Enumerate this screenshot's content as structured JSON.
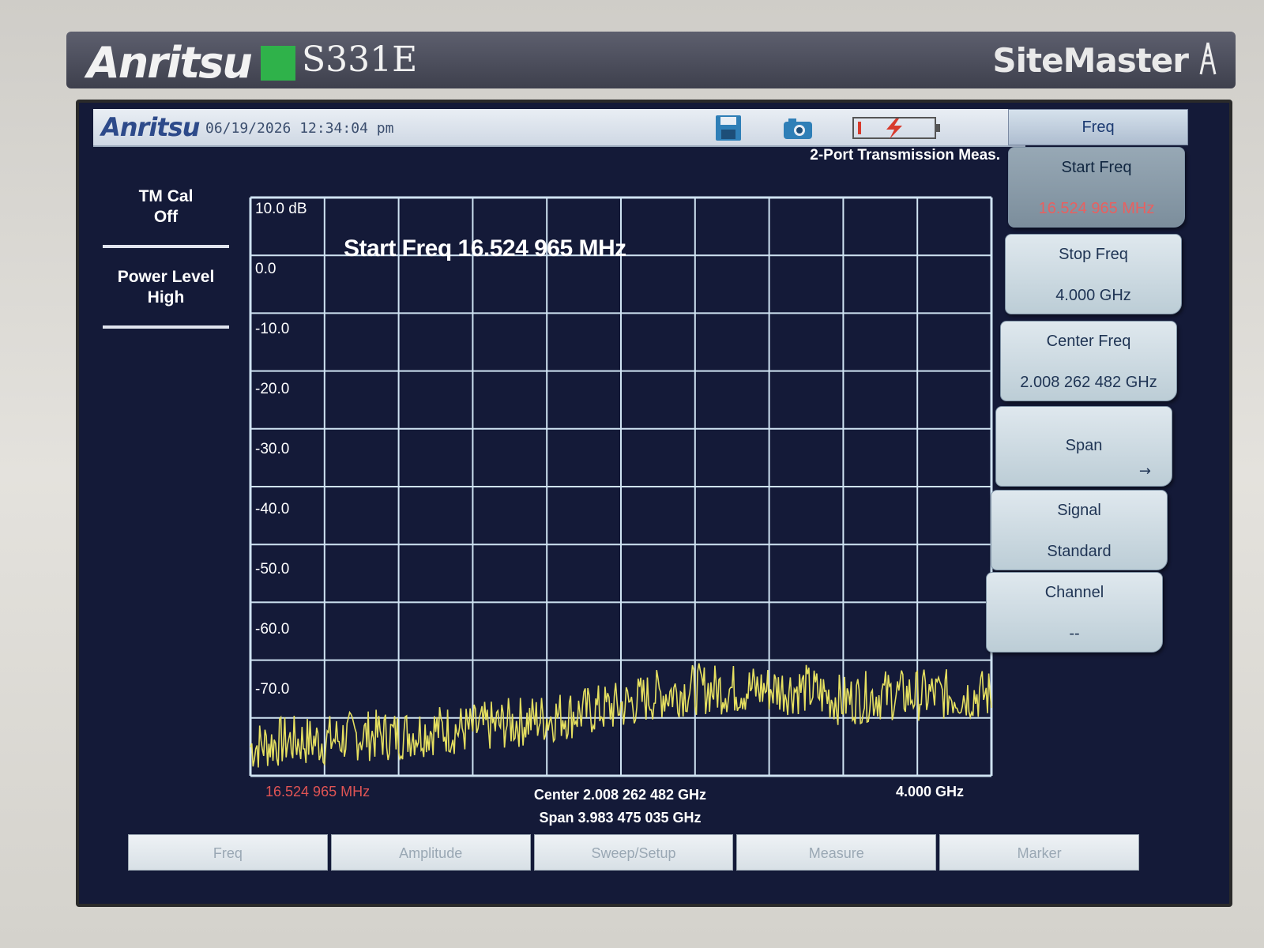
{
  "device": {
    "brand": "Anritsu",
    "model": "S331E",
    "product": "SiteMaster"
  },
  "status": {
    "logo": "Anritsu",
    "datetime": "06/19/2026 12:34:04 pm",
    "measurement_title": "2-Port Transmission Meas."
  },
  "left_panel": {
    "items": [
      {
        "line1": "TM Cal",
        "line2": "Off"
      },
      {
        "line1": "Power Level",
        "line2": "High"
      }
    ]
  },
  "plot": {
    "annotation": "Start Freq 16.524 965 MHz",
    "y_tick_labels": [
      "10.0 dB",
      "0.0",
      "-10.0",
      "-20.0",
      "-30.0",
      "-40.0",
      "-50.0",
      "-60.0",
      "-70.0"
    ],
    "x_start": "16.524 965 MHz",
    "x_center": "Center 2.008 262 482 GHz",
    "x_span": "Span 3.983 475 035 GHz",
    "x_stop": "4.000 GHz",
    "trace_color": "#e6e060",
    "grid_color": "#cfe3f2"
  },
  "chart_data": {
    "type": "line",
    "ylim": [
      -90,
      10
    ],
    "xlim_ghz": [
      0.016524965,
      4.0
    ],
    "series": [
      {
        "x_ghz": [
          0.0165,
          0.2,
          0.4,
          0.6,
          0.8,
          1.0,
          1.2,
          1.4,
          1.6,
          1.8,
          2.0,
          2.2,
          2.4,
          2.6,
          2.8,
          3.0,
          3.2,
          3.4,
          3.6,
          3.8,
          4.0
        ],
        "y_db": [
          -85,
          -84,
          -84,
          -83,
          -83,
          -82,
          -82,
          -81,
          -80,
          -79,
          -78,
          -76,
          -75,
          -75,
          -75,
          -75,
          -77,
          -76,
          -76,
          -76,
          -76
        ]
      }
    ]
  },
  "softkeys": {
    "title": "Freq",
    "keys": [
      {
        "line1": "Start Freq",
        "line2": "16.524 965 MHz"
      },
      {
        "line1": "Stop Freq",
        "line2": "4.000 GHz"
      },
      {
        "line1": "Center Freq",
        "line2": "2.008 262 482 GHz"
      },
      {
        "label": "Span"
      },
      {
        "line1": "Signal",
        "line2": "Standard"
      },
      {
        "line1": "Channel",
        "line2": "--"
      }
    ]
  },
  "bottom_tabs": [
    "Freq",
    "Amplitude",
    "Sweep/Setup",
    "Measure",
    "Marker"
  ]
}
